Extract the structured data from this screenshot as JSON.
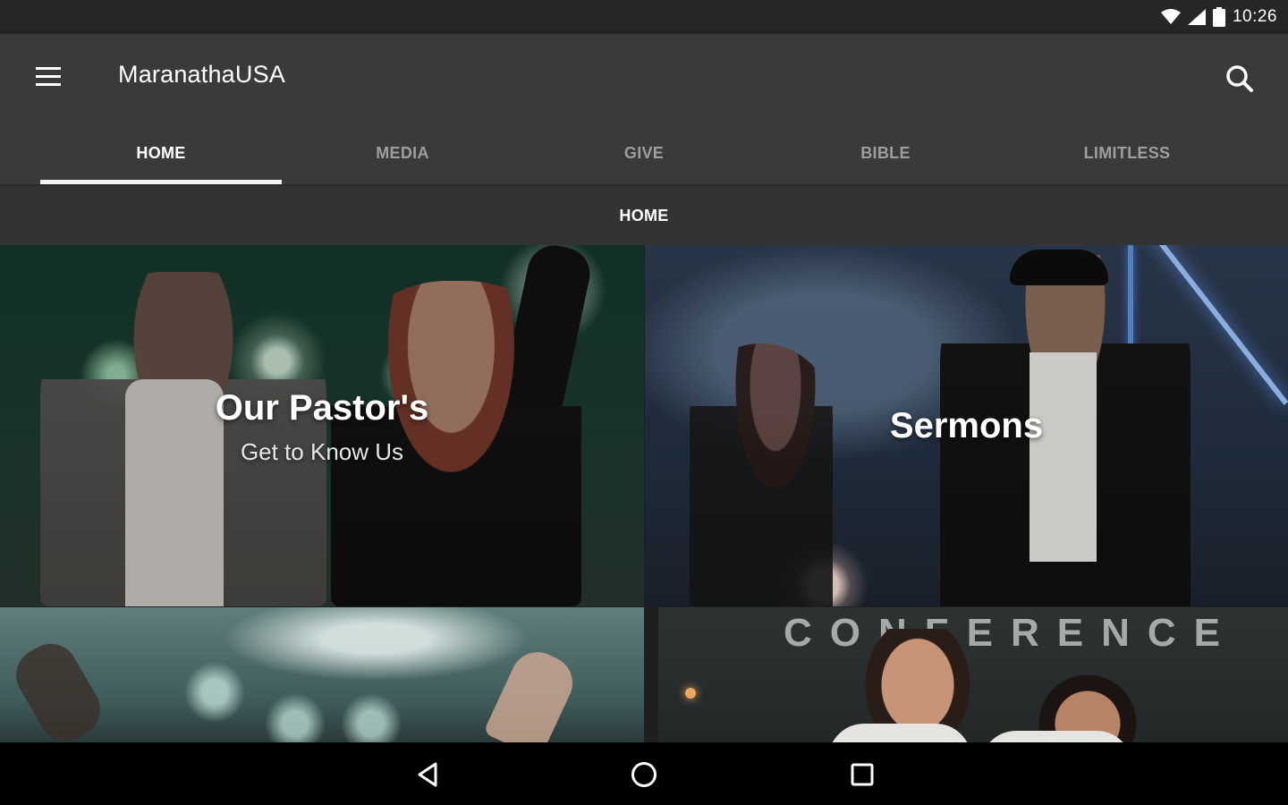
{
  "status_bar": {
    "time": "10:26",
    "icons": [
      "wifi-icon",
      "cell-signal-icon",
      "battery-icon"
    ]
  },
  "app_bar": {
    "title": "MaranathaUSA",
    "menu_icon": "hamburger-menu-icon",
    "search_icon": "search-icon"
  },
  "tabs": [
    {
      "label": "HOME",
      "active": true
    },
    {
      "label": "MEDIA",
      "active": false
    },
    {
      "label": "GIVE",
      "active": false
    },
    {
      "label": "BIBLE",
      "active": false
    },
    {
      "label": "LIMITLESS",
      "active": false
    }
  ],
  "subheader": {
    "title": "HOME"
  },
  "tiles": [
    {
      "title": "Our Pastor's",
      "subtitle": "Get to Know Us"
    },
    {
      "title": "Sermons",
      "subtitle": ""
    },
    {
      "title": "",
      "subtitle": ""
    },
    {
      "title": "",
      "subtitle": "",
      "image_text": "CONFERENCE"
    }
  ],
  "nav_bar": {
    "icons": [
      "back-icon",
      "home-icon",
      "recent-apps-icon"
    ]
  },
  "colors": {
    "app_bar_bg": "#3a3a3a",
    "subheader_bg": "#333333",
    "status_bar_bg": "#262626",
    "tab_active": "#ffffff",
    "tab_inactive": "#9e9e9e",
    "nav_bar_bg": "#000000"
  }
}
